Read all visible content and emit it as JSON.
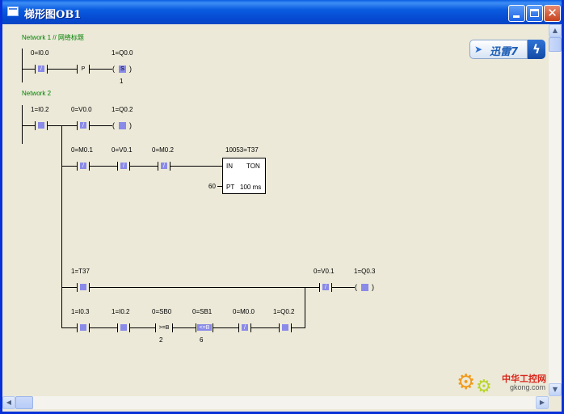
{
  "window": {
    "title": "梯形图OB1",
    "minimize_glyph": "",
    "maximize_glyph": "",
    "close_glyph": "✕"
  },
  "networks": [
    {
      "title": "Network 1 // 网络标题"
    },
    {
      "title": "Network 2"
    }
  ],
  "net1": {
    "contact1": {
      "label": "0=I0.0",
      "symbol": "/"
    },
    "contact2": {
      "symbol": "P"
    },
    "coil": {
      "label": "1=Q0.0",
      "symbol": "S",
      "count": "1"
    }
  },
  "net2": {
    "row1": {
      "c1": {
        "label": "1=I0.2"
      },
      "c2": {
        "label": "0=V0.0",
        "symbol": "/"
      },
      "coil": {
        "label": "1=Q0.2"
      }
    },
    "row2": {
      "c1": {
        "label": "0=M0.1",
        "symbol": "/"
      },
      "c2": {
        "label": "0=V0.1",
        "symbol": "/"
      },
      "c3": {
        "label": "0=M0.2",
        "symbol": "/"
      },
      "timer": {
        "label": "10053=T37",
        "in": "IN",
        "type": "TON",
        "pt": "PT",
        "pt_value": "60",
        "base": "100 ms"
      }
    },
    "row3": {
      "c1": {
        "label": "1=T37"
      },
      "c2": {
        "label": "0=V0.1",
        "symbol": "/"
      },
      "coil": {
        "label": "1=Q0.3"
      }
    },
    "row4": {
      "c1": {
        "label": "1=I0.3"
      },
      "c2": {
        "label": "1=I0.2"
      },
      "c3": {
        "label": "0=SB0",
        "symbol": ">=B",
        "value": "2"
      },
      "c4": {
        "label": "0=SB1",
        "symbol": "<=B",
        "value": "6"
      },
      "c5": {
        "label": "0=M0.0",
        "symbol": "/"
      },
      "c6": {
        "label": "1=Q0.2"
      }
    }
  },
  "scrollbars": {
    "up": "▲",
    "down": "▼",
    "left": "◀",
    "right": "▶"
  },
  "overlays": {
    "xunlei_text": "迅雷7",
    "xunlei_bolt": "ϟ",
    "watermark_cn": "中华工控网",
    "watermark_en": "gkong.com"
  },
  "colors": {
    "titlebar": "#0548cf",
    "client": "#ece9d8",
    "contact_fill": "#8a8ae8",
    "network_title": "#008000"
  }
}
